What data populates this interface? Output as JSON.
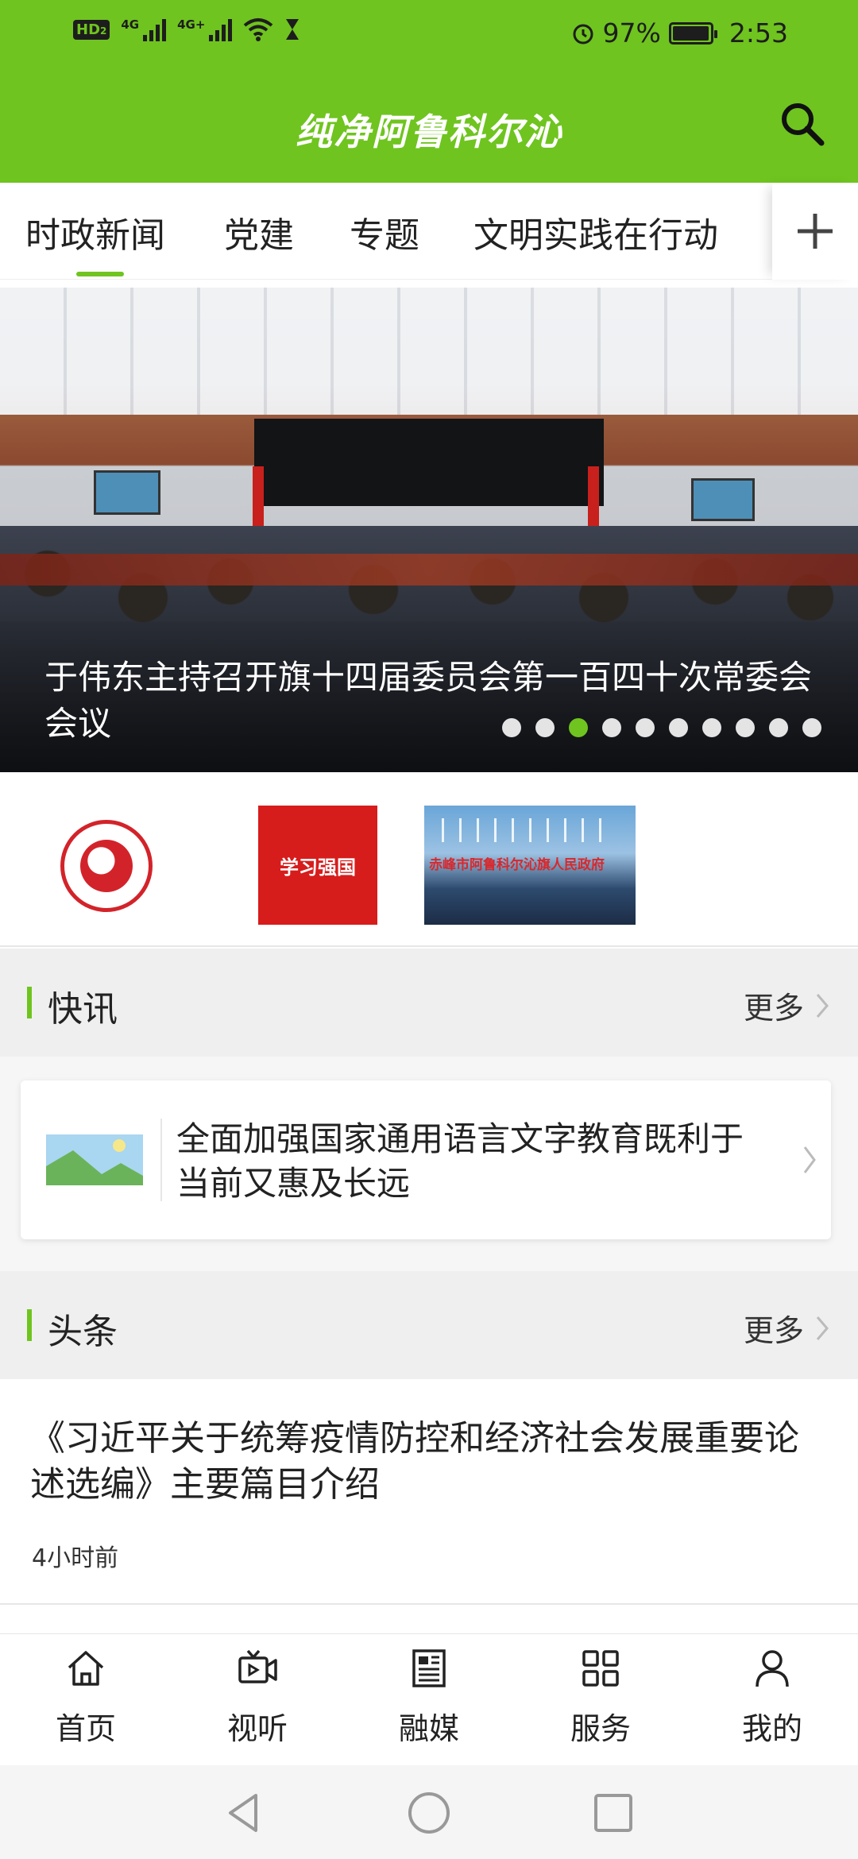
{
  "status_bar": {
    "left": [
      "HD",
      "2",
      "4G",
      "4G+"
    ],
    "battery": "97%",
    "battery_level": 0.97,
    "time": "2:53"
  },
  "header": {
    "app_title": "纯净阿鲁科尔沁"
  },
  "tabs": [
    {
      "label": "时政新闻",
      "active": true
    },
    {
      "label": "党建",
      "active": false
    },
    {
      "label": "专题",
      "active": false
    },
    {
      "label": "文明实践在行动",
      "active": false
    }
  ],
  "banner": {
    "caption": "于伟东主持召开旗十四届委员会第一百四十次常委会会议",
    "slide_count": 10,
    "active_slide": 3
  },
  "partners": {
    "xuexi_label": "学习强国",
    "gov_label": "赤峰市阿鲁科尔沁旗人民政府"
  },
  "kuaixun": {
    "title": "快讯",
    "more": "更多",
    "item": "全面加强国家通用语言文字教育既利于当前又惠及长远"
  },
  "toutiao": {
    "title": "头条",
    "more": "更多",
    "headline": "《习近平关于统筹疫情防控和经济社会发展重要论述选编》主要篇目介绍",
    "time": "4小时前"
  },
  "bottom_nav": [
    {
      "label": "首页",
      "icon": "home-icon"
    },
    {
      "label": "视听",
      "icon": "video-icon"
    },
    {
      "label": "融媒",
      "icon": "newspaper-icon"
    },
    {
      "label": "服务",
      "icon": "grid-icon"
    },
    {
      "label": "我的",
      "icon": "person-icon"
    }
  ],
  "colors": {
    "brand": "#6fc41f",
    "section_bg": "#efefef"
  }
}
